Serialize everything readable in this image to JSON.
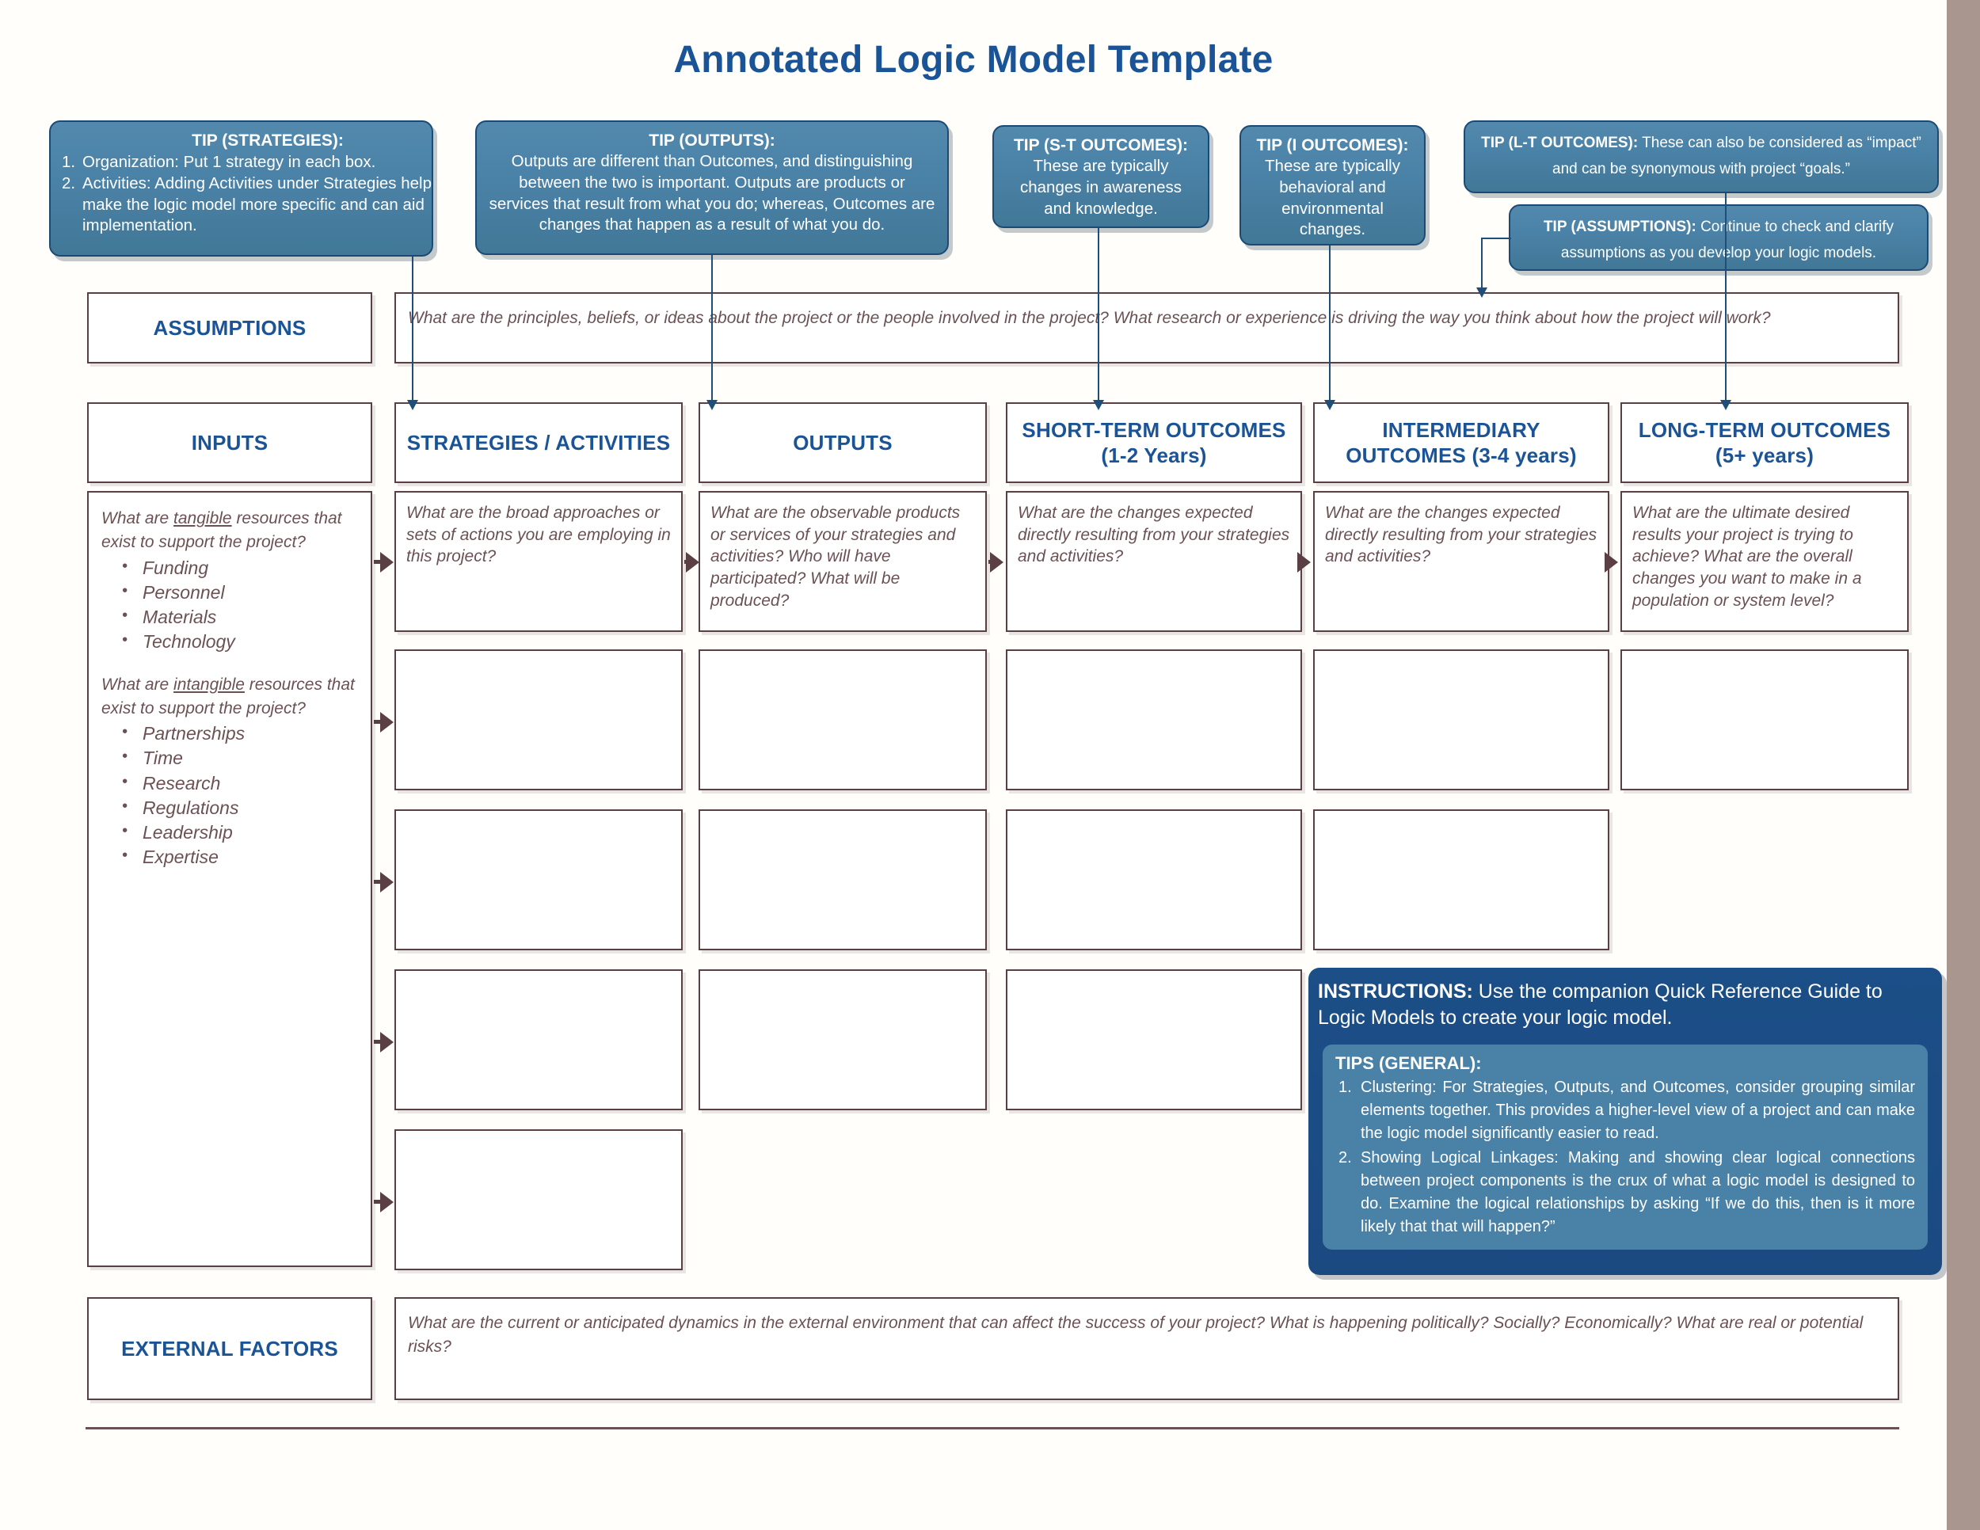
{
  "document": {
    "title": "Annotated Logic Model Template",
    "title_color": "#1b5496",
    "accent_box_color": "#4a81a6",
    "instructions_panel_color": "#1c4e87",
    "grid_border_color": "#5a4044"
  },
  "tips": {
    "strategies": {
      "heading": "TIP (STRATEGIES):",
      "items": [
        "Organization: Put 1 strategy in each box.",
        "Activities: Adding Activities under Strategies helps make the logic model more specific and can aid implementation."
      ]
    },
    "outputs": {
      "heading": "TIP (OUTPUTS):",
      "body": "Outputs are different than Outcomes, and distinguishing between the two is important. Outputs are products or services that result from what you do; whereas, Outcomes are changes that happen as a result of what you do."
    },
    "short_term_outcomes": {
      "heading": "TIP (S-T OUTCOMES):",
      "body": "These are typically changes in awareness and knowledge."
    },
    "intermediary_outcomes": {
      "heading": "TIP (I OUTCOMES):",
      "body": "These are typically behavioral and environmental changes."
    },
    "long_term_outcomes": {
      "heading": "TIP (L-T OUTCOMES):",
      "body": "These can also be considered as “impact” and can be synonymous with project “goals.”"
    },
    "assumptions": {
      "heading": "TIP (ASSUMPTIONS):",
      "body": "Continue to check and clarify assumptions as you develop your logic models."
    }
  },
  "rows": {
    "assumptions": {
      "label": "ASSUMPTIONS",
      "prompt": "What are the principles, beliefs, or ideas about the project or the people involved in the project? What research or experience is driving the way you think about how the project will work?"
    },
    "external_factors": {
      "label": "EXTERNAL FACTORS",
      "prompt": "What are the current or anticipated dynamics in the external environment that can affect the success of your project? What is happening politically? Socially? Economically? What are real or potential risks?"
    }
  },
  "columns": {
    "inputs": {
      "label": "INPUTS",
      "tangible_question_pre": "What are ",
      "tangible_question_underline": "tangible",
      "tangible_question_post": " resources that exist to support the project?",
      "tangible_items": [
        "Funding",
        "Personnel",
        "Materials",
        "Technology"
      ],
      "intangible_question_pre": "What are ",
      "intangible_question_underline": "intangible",
      "intangible_question_post": " resources that exist to support the project?",
      "intangible_items": [
        "Partnerships",
        "Time",
        "Research",
        "Regulations",
        "Leadership",
        "Expertise"
      ]
    },
    "strategies": {
      "label": "STRATEGIES / ACTIVITIES",
      "prompt": "What are the broad approaches or sets of actions you are employing in this project?",
      "empty_boxes": 4
    },
    "outputs": {
      "label": "OUTPUTS",
      "prompt": "What are the observable products or services of your strategies and activities? Who will have participated? What will be produced?",
      "empty_boxes": 3
    },
    "short_term_outcomes": {
      "label_line1": "SHORT-TERM OUTCOMES",
      "label_line2": "(1-2 Years)",
      "prompt": "What are the changes expected directly resulting from your strategies and activities?",
      "empty_boxes": 3
    },
    "intermediary_outcomes": {
      "label_line1": "INTERMEDIARY",
      "label_line2": "OUTCOMES (3-4 years)",
      "prompt": "What are the changes expected directly resulting from your strategies and activities?",
      "empty_boxes": 2
    },
    "long_term_outcomes": {
      "label_line1": "LONG-TERM OUTCOMES",
      "label_line2": "(5+ years)",
      "prompt": "What are the ultimate desired results your project is trying to achieve? What are the overall changes you want to make in a population or system level?",
      "empty_boxes": 1
    }
  },
  "instructions": {
    "heading": "INSTRUCTIONS:",
    "body": "Use the companion Quick Reference Guide to Logic Models to create your logic model.",
    "tips_heading": "TIPS (GENERAL):",
    "tips": [
      "Clustering: For Strategies, Outputs, and Outcomes, consider grouping similar elements together. This provides a higher-level view of a project and can make the logic model significantly easier to read.",
      "Showing Logical Linkages: Making and showing clear logical connections between project components is the crux of what a logic model is designed to do. Examine the logical relationships by asking “If we do this, then is it more likely that that will happen?”"
    ]
  }
}
